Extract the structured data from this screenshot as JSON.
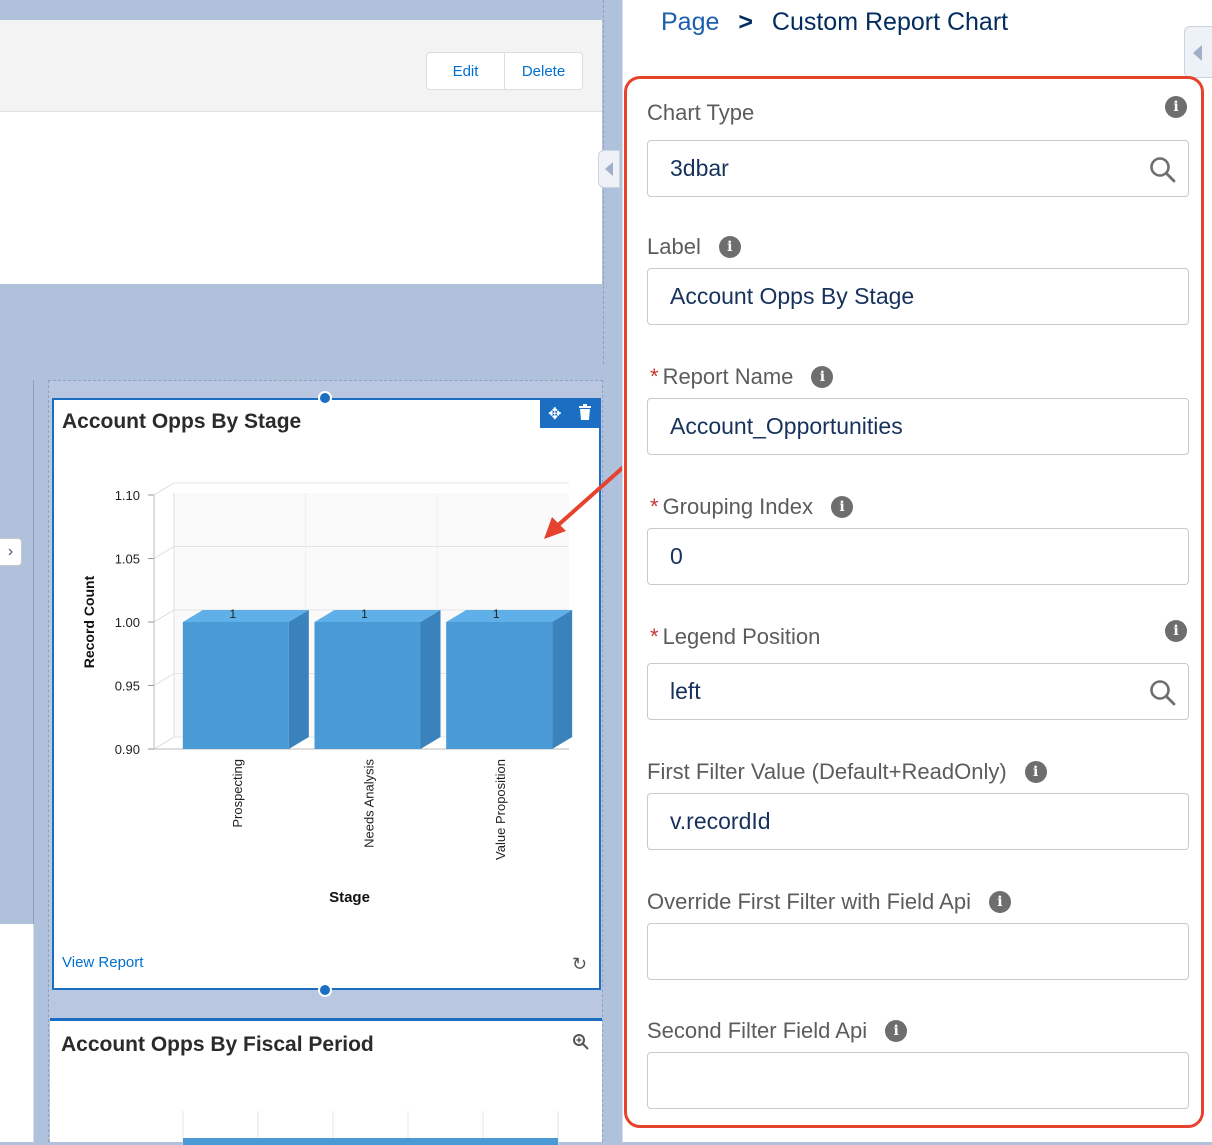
{
  "header": {
    "edit_label": "Edit",
    "delete_label": "Delete"
  },
  "component1": {
    "title": "Account Opps By Stage",
    "view_report": "View Report"
  },
  "component2": {
    "title": "Account Opps By Fiscal Period"
  },
  "chart_data": {
    "type": "bar",
    "title": "",
    "xlabel": "Stage",
    "ylabel": "Record Count",
    "categories": [
      "Prospecting",
      "Needs Analysis",
      "Value Proposition"
    ],
    "values": [
      1,
      1,
      1
    ],
    "data_labels": [
      "1",
      "1",
      "1"
    ],
    "ylim": [
      0.9,
      1.1
    ],
    "yticks": [
      "0.90",
      "0.95",
      "1.00",
      "1.05",
      "1.10"
    ],
    "style": "3d",
    "color": "#4a9ad6",
    "grid": true
  },
  "panel": {
    "breadcrumb_root": "Page",
    "breadcrumb_sep": ">",
    "breadcrumb_current": "Custom Report Chart",
    "fields": [
      {
        "label": "Chart Type",
        "value": "3dbar",
        "required": false,
        "lookup": true
      },
      {
        "label": "Label",
        "value": "Account Opps By Stage",
        "required": false,
        "lookup": false
      },
      {
        "label": "Report Name",
        "value": "Account_Opportunities",
        "required": true,
        "lookup": false
      },
      {
        "label": "Grouping Index",
        "value": "0",
        "required": true,
        "lookup": false
      },
      {
        "label": "Legend Position",
        "value": "left",
        "required": true,
        "lookup": true
      },
      {
        "label": "First Filter Value (Default+ReadOnly)",
        "value": "v.recordId",
        "required": false,
        "lookup": false
      },
      {
        "label": "Override First Filter with Field Api",
        "value": "",
        "required": false,
        "lookup": false
      },
      {
        "label": "Second Filter Field Api",
        "value": "",
        "required": false,
        "lookup": false
      }
    ],
    "required_mark": "*",
    "info_glyph": "i"
  },
  "colors": {
    "accent": "#1b6ec2",
    "highlight": "#e5432e",
    "bar": "#4a9ad6",
    "canvas": "#b0c1dc"
  }
}
